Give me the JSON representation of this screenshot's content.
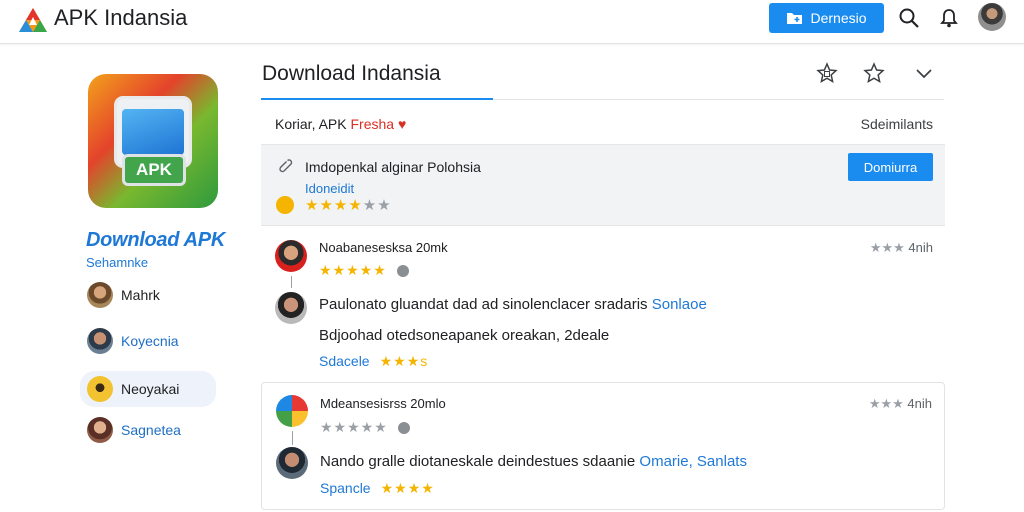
{
  "header": {
    "brand": "APK Indansia",
    "demo_button": "Dernesio",
    "icons": [
      "apk-logo-icon",
      "folder-plus-icon",
      "search-icon",
      "bell-icon",
      "avatar"
    ],
    "accent_color": "#1a8cf0"
  },
  "sidebar": {
    "app_badge": "APK",
    "app_title": "Download APK",
    "app_subtitle": "Sehamnke",
    "users": [
      {
        "name": "Mahrk"
      },
      {
        "name": "Koyecnia"
      },
      {
        "name": "Neoyakai"
      },
      {
        "name": "Sagnetea"
      }
    ]
  },
  "main": {
    "title": "Download Indansia",
    "header_icons": [
      "star-outline-icon",
      "star-icon",
      "chevron-down-icon"
    ],
    "label_left": "Koriar, APK",
    "label_accent": "Fresha",
    "label_right": "Sdeimilants",
    "featured": {
      "text": "Imdopenkal alginar Polohsia",
      "sub": "Idoneidit",
      "button": "Domiurra",
      "rating_stars": "★★★★",
      "rating_empty": "★★"
    },
    "reviews": [
      {
        "name": "Noabanesesksa 20mk",
        "time": "4nih",
        "time_stars": "★★★",
        "stars_gold": "★★★★★",
        "stars_grey": "",
        "text_main": "Paulonato gluandat dad ad sinolenclacer sradaris",
        "text_link": "Sonlaoe",
        "text_second": "Bdjoohad otedsoneapanek oreakan, 2deale",
        "foot_label": "Sdacele",
        "foot_stars": "★★★s"
      },
      {
        "name": "Mdeansesisrss 20mlo",
        "time": "4nih",
        "time_stars": "★★★",
        "stars_gold": "",
        "stars_grey": "★★★★★",
        "text_main": "Nando gralle diotaneskale deindestues sdaanie",
        "text_link": "Omarie, Sanlats",
        "text_second": "",
        "foot_label": "Spancle",
        "foot_stars": "★★★★"
      }
    ]
  }
}
